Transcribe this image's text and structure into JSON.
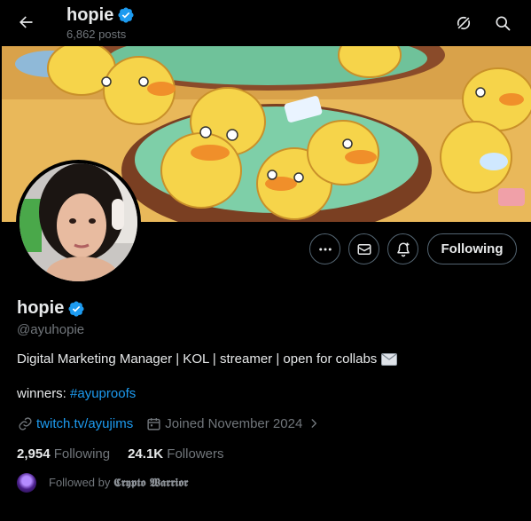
{
  "header": {
    "name": "hopie",
    "posts_count": "6,862 posts",
    "back_icon": "arrow-left-icon",
    "grok_icon": "grok-icon",
    "search_icon": "search-icon"
  },
  "profile": {
    "name": "hopie",
    "handle": "@ayuhopie",
    "bio": "Digital Marketing Manager | KOL | streamer | open for collabs",
    "bio_emoji": "envelope-icon",
    "winners_label": "winners:",
    "winners_tag": "#ayuproofs",
    "website": "twitch.tv/ayujims",
    "joined": "Joined November 2024",
    "following_count": "2,954",
    "following_label": "Following",
    "followers_count": "24.1K",
    "followers_label": "Followers",
    "followed_by_prefix": "Followed by",
    "followed_by_name": "𝕮𝖗𝖞𝖕𝖙𝖔 𝖂𝖆𝖗𝖗𝖎𝖔𝖗"
  },
  "actions": {
    "more_icon": "more-icon",
    "message_icon": "mail-icon",
    "notify_icon": "bell-plus-icon",
    "following_label": "Following"
  },
  "colors": {
    "accent": "#1d9bf0",
    "muted": "#71767b",
    "verified": "#1d9bf0"
  }
}
